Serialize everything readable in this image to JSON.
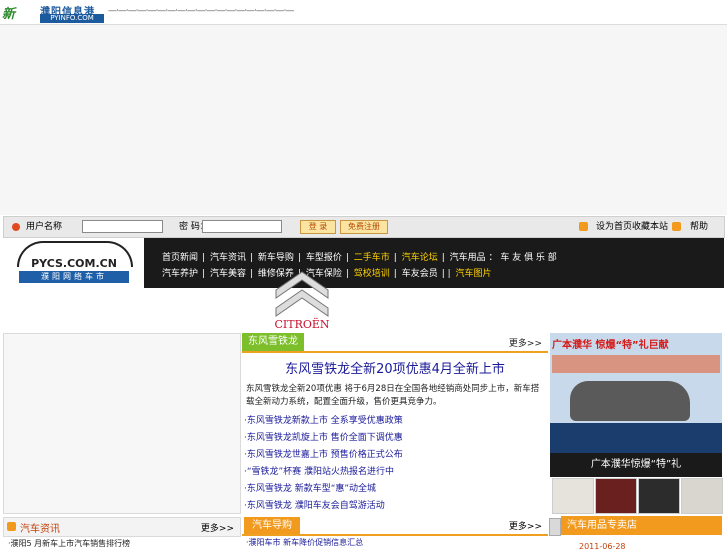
{
  "header": {
    "logo_mark": "新",
    "logo_cn": "濮阳信息港",
    "logo_en": "PYINFO.COM",
    "deco": "—·—·—·—·—·—·—·—·—·—·—·—·—·—·—·—·—·—·—"
  },
  "login_bar": {
    "label_user": "用户名称",
    "label_password": "密 码：",
    "login_button": "登 录",
    "register_button": "免费注册",
    "link_home": "设为首页收藏本站",
    "link_help": "帮助"
  },
  "brand": {
    "url": "PYCS.COM.CN",
    "name": "濮阳网络车市"
  },
  "nav": {
    "row1": [
      "首页新闻",
      "汽车资讯",
      "新车导购",
      "车型报价",
      "二手车市",
      "汽车论坛",
      "汽车用品 ： 车 友 俱 乐 部"
    ],
    "row2": [
      "汽车养护",
      "汽车美容",
      "维修保养",
      "汽车保险",
      "驾校培训",
      "车友会员",
      "汽车图片"
    ]
  },
  "citroen": {
    "brand": "CITROËN"
  },
  "center": {
    "tab_title": "东风雪铁龙",
    "more": "更多>>",
    "headline": "东风雪铁龙全新20项优惠4月全新上市",
    "summary": "东风雪铁龙全新20项优惠 将于6月28日在全国各地经销商处同步上市，新车搭载全新动力系统，配置全面升级，售价更具竞争力。",
    "news": [
      "·东风雪铁龙新款上市 全系享受优惠政策",
      "·东风雪铁龙凯旋上市 售价全面下调优惠",
      "·东风雪铁龙世嘉上市 预售价格正式公布",
      "·“雪铁龙”杯赛 濮阳站火热报名进行中",
      "·东风雪铁龙 新款车型“惠”动全城",
      "·东风雪铁龙 濮阳车友会自驾游活动"
    ]
  },
  "bottom": {
    "left_title": "汽车资讯",
    "left_more": "更多>>",
    "left_item": "·濮阳5 月新车上市汽车销售排行榜",
    "center_title": "汽车导购",
    "center_more": "更多>>",
    "center_item": "·濮阳车市 新车降价促销信息汇总",
    "right_title": "汽车用品专卖店",
    "right_date": "2011-06-28"
  },
  "promo": {
    "title": "广本濮华 惊爆“特”礼巨献",
    "caption": "广本濮华惊爆“特”礼"
  }
}
